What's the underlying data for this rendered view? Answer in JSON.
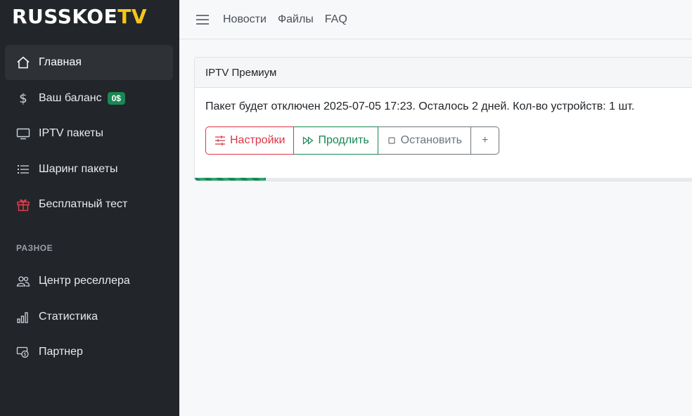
{
  "brand": {
    "part1": "RUSSKOE",
    "part2": "TV"
  },
  "sidebar": {
    "items": [
      {
        "label": "Главная",
        "icon": "home-icon",
        "active": true
      },
      {
        "label": "Ваш баланс",
        "icon": "dollar-icon",
        "badge": "0$"
      },
      {
        "label": "IPTV пакеты",
        "icon": "tv-icon"
      },
      {
        "label": "Шаринг пакеты",
        "icon": "list-icon"
      },
      {
        "label": "Бесплатный тест",
        "icon": "gift-icon"
      }
    ],
    "section_title": "РАЗНОЕ",
    "items2": [
      {
        "label": "Центр реселлера",
        "icon": "people-icon"
      },
      {
        "label": "Статистика",
        "icon": "bar-chart-icon"
      },
      {
        "label": "Партнер",
        "icon": "cash-icon"
      }
    ]
  },
  "topbar": {
    "links": [
      "Новости",
      "Файлы",
      "FAQ"
    ]
  },
  "card": {
    "title": "IPTV Премиум",
    "text": "Пакет будет отключен 2025-07-05 17:23. Осталось 2 дней. Кол-во устройств: 1 шт.",
    "buttons": {
      "settings": "Настройки",
      "extend": "Продлить",
      "stop": "Остановить",
      "more": "+"
    },
    "progress_percent": 14
  },
  "colors": {
    "sidebar_bg": "#222529",
    "brand_accent": "#f5c518",
    "success": "#198754",
    "danger": "#dc3545",
    "secondary": "#6c757d"
  }
}
